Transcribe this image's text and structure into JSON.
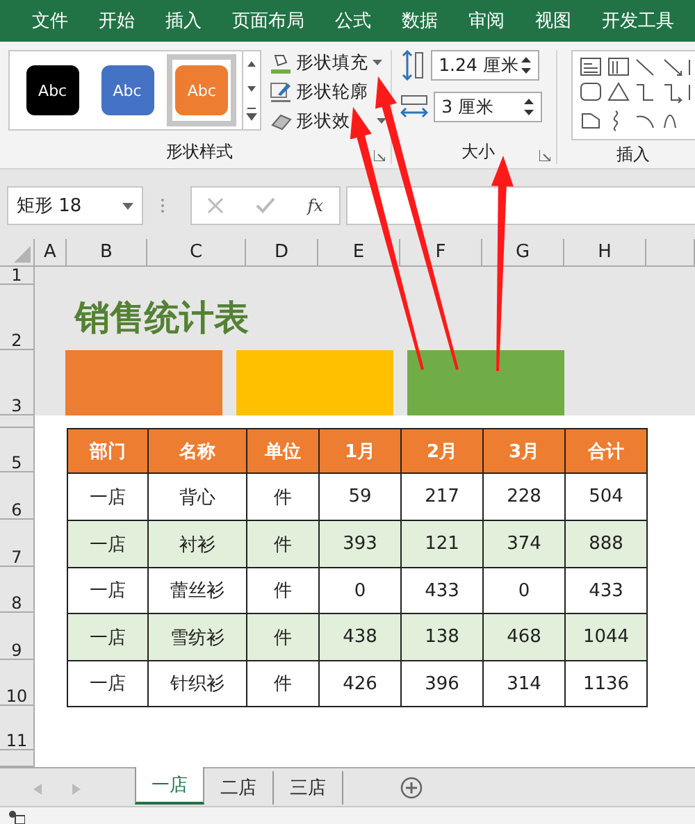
{
  "menu": [
    "文件",
    "开始",
    "插入",
    "页面布局",
    "公式",
    "数据",
    "审阅",
    "视图",
    "开发工具"
  ],
  "ribbon": {
    "style_gallery": [
      {
        "label": "Abc",
        "color": "#000000",
        "selected": false
      },
      {
        "label": "Abc",
        "color": "#4472c4",
        "selected": false
      },
      {
        "label": "Abc",
        "color": "#ed7d31",
        "selected": true
      }
    ],
    "shape_buttons": [
      {
        "label": "形状填充",
        "kind": "fill"
      },
      {
        "label": "形状轮廓",
        "kind": "outline"
      },
      {
        "label": "形状效",
        "kind": "effect"
      }
    ],
    "style_group": "形状样式",
    "size": [
      {
        "kind": "height",
        "value": "1.24 厘米"
      },
      {
        "kind": "width",
        "value": "3 厘米"
      }
    ],
    "size_group": "大小",
    "insert_group": "插入"
  },
  "formula_bar": {
    "name_box": "矩形 18",
    "fx": "fx"
  },
  "sheet": {
    "columns": [
      "A",
      "B",
      "C",
      "D",
      "E",
      "F",
      "G",
      "H"
    ],
    "rows": [
      {
        "label": "1"
      },
      {
        "label": "2"
      },
      {
        "label": "3"
      },
      {},
      {
        "label": "5"
      },
      {
        "label": "6"
      },
      {
        "label": "7"
      },
      {
        "label": "8"
      },
      {
        "label": "9"
      },
      {
        "label": "10"
      },
      {
        "label": "11"
      },
      {}
    ],
    "title": "销售统计表",
    "shapes": [
      {
        "color": "#ed7d31"
      },
      {
        "color": "#ffc000"
      },
      {
        "color": "#70ad47"
      }
    ]
  },
  "table": {
    "columns": [
      "部门",
      "名称",
      "单位",
      "1月",
      "2月",
      "3月",
      "合计"
    ],
    "rows": [
      [
        "一店",
        "背心",
        "件",
        "59",
        "217",
        "228",
        "504"
      ],
      [
        "一店",
        "衬衫",
        "件",
        "393",
        "121",
        "374",
        "888"
      ],
      [
        "一店",
        "蕾丝衫",
        "件",
        "0",
        "433",
        "0",
        "433"
      ],
      [
        "一店",
        "雪纺衫",
        "件",
        "438",
        "138",
        "468",
        "1044"
      ],
      [
        "一店",
        "针织衫",
        "件",
        "426",
        "396",
        "314",
        "1136"
      ]
    ]
  },
  "sheet_tabs": [
    {
      "label": "一店",
      "selected": true
    },
    {
      "label": "二店",
      "selected": false
    },
    {
      "label": "三店",
      "selected": false
    }
  ]
}
